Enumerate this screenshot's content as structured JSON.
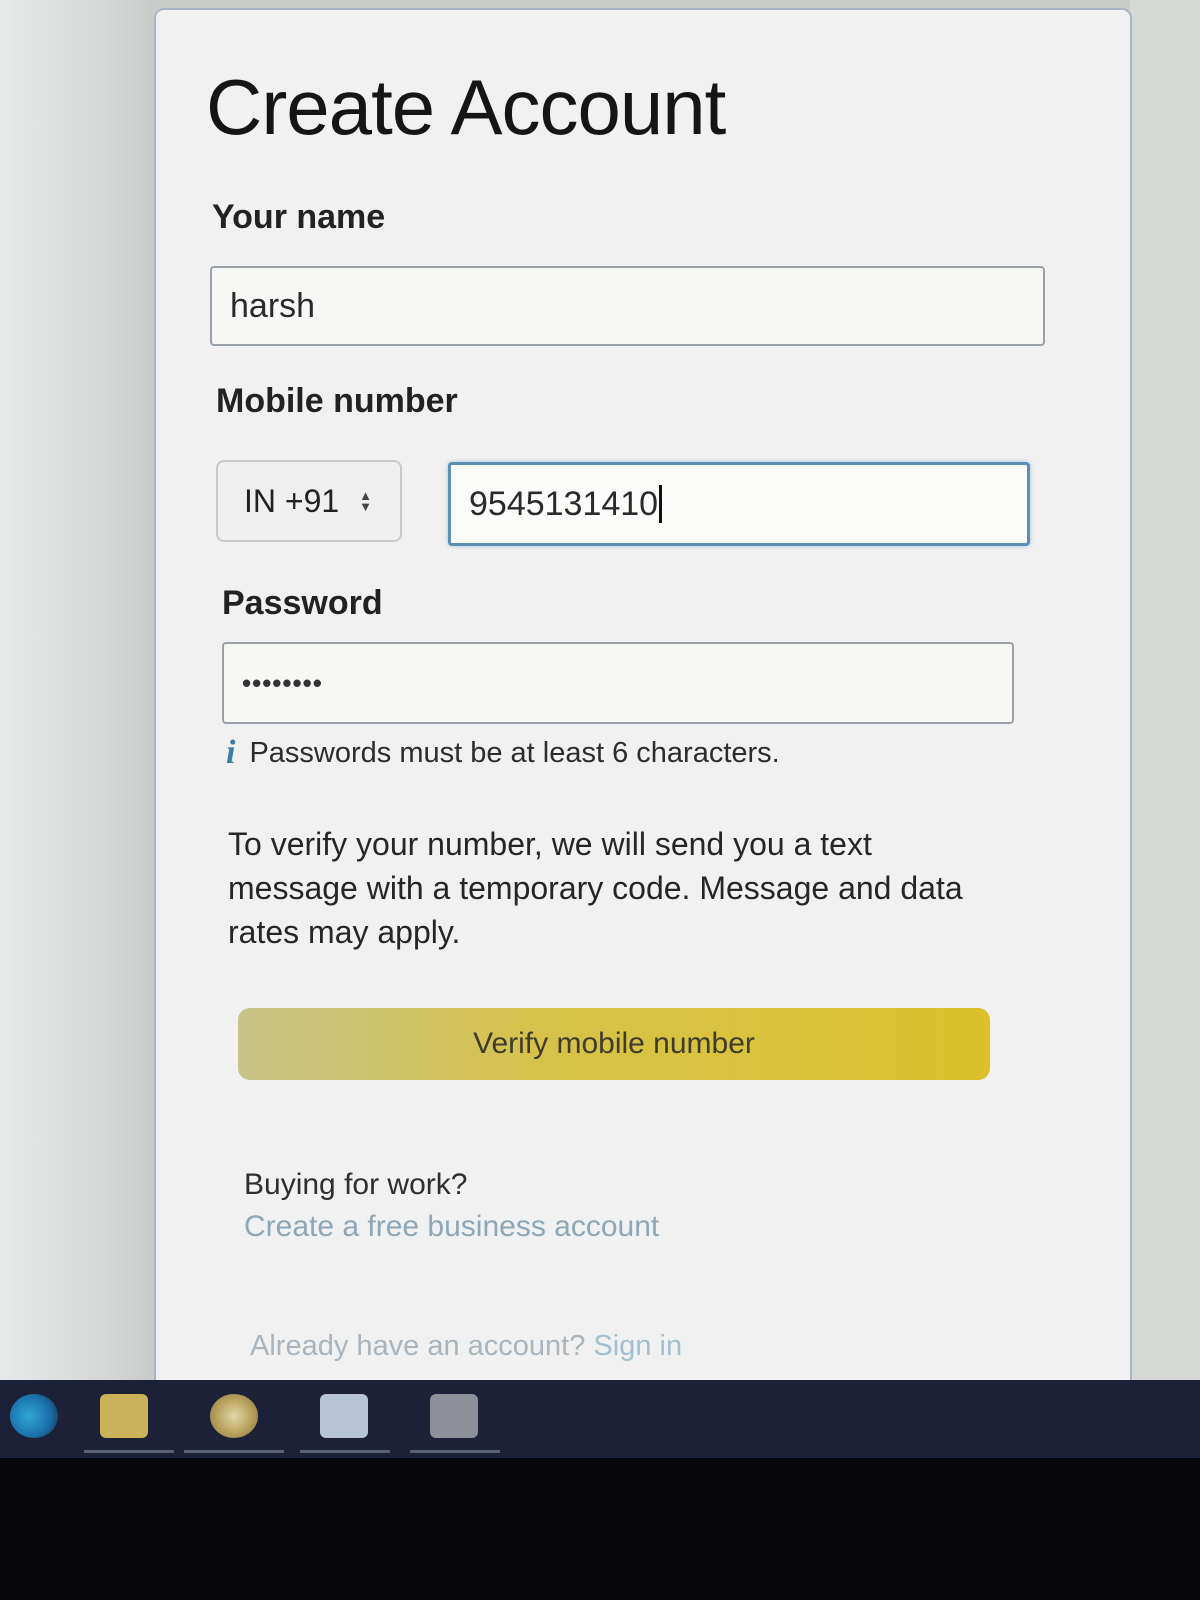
{
  "form": {
    "title": "Create Account",
    "name": {
      "label": "Your name",
      "value": "harsh"
    },
    "mobile": {
      "label": "Mobile number",
      "country_code": "IN +91",
      "value": "9545131410"
    },
    "password": {
      "label": "Password",
      "masked_value": "••••••••",
      "hint": "Passwords must be at least 6 characters."
    },
    "verify_notice": "To verify your number, we will send you a text message with a temporary code. Message and data rates may apply.",
    "verify_button": "Verify mobile number",
    "business": {
      "question": "Buying for work?",
      "link": "Create a free business account"
    },
    "signin": {
      "prompt": "Already have an account?",
      "link": "Sign in"
    }
  },
  "icons": {
    "info": "info-icon",
    "country_select": "chevron-updown-icon"
  },
  "colors": {
    "button": "#d6c236",
    "link": "#8ea7b8",
    "focus": "#5c8fb0",
    "taskbar": "#1c2138"
  }
}
